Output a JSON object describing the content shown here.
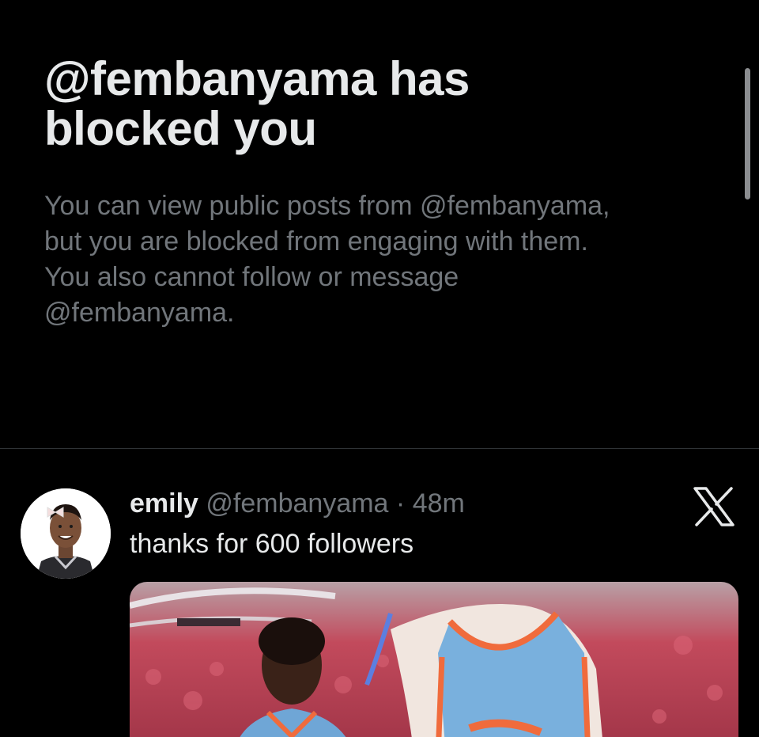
{
  "blocked_notice": {
    "title_lines": [
      "@fembanyama has",
      "blocked you"
    ],
    "description_lines": [
      "You can view public posts from @fembanyama,",
      "but you are blocked from engaging with them.",
      "You also cannot follow or message",
      "@fembanyama."
    ]
  },
  "post": {
    "display_name": "emily",
    "handle": "@fembanyama",
    "separator": "·",
    "time": "48m",
    "text": "thanks for 600 followers",
    "close_icon": "x-logo-icon"
  },
  "colors": {
    "background": "#000000",
    "primary_text": "#e7e9ea",
    "secondary_text": "#71767b",
    "divider": "#2f3336"
  }
}
